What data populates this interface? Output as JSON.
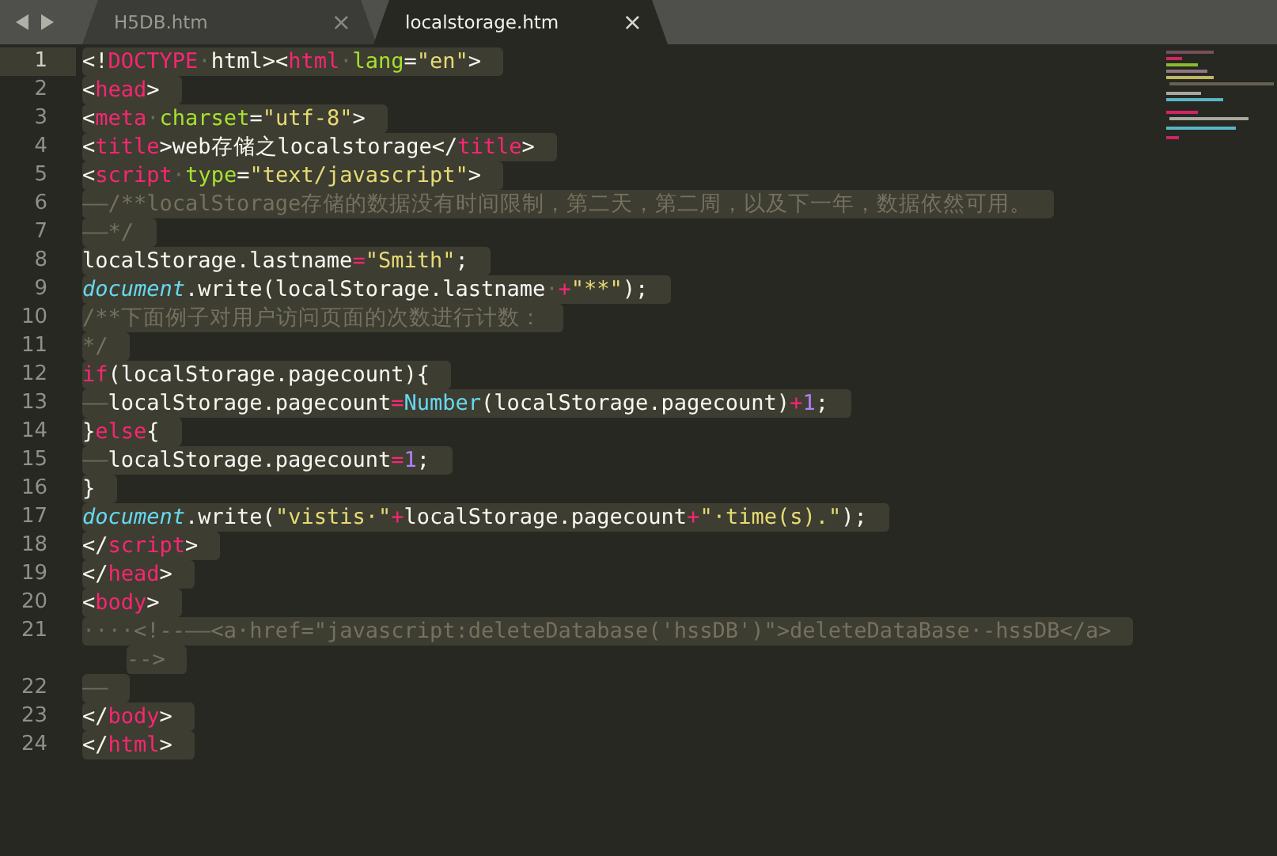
{
  "tabs": [
    {
      "label": "H5DB.htm",
      "close": "×",
      "selected": false
    },
    {
      "label": "localstorage.htm",
      "close": "×",
      "selected": true
    }
  ],
  "lines": [
    {
      "number": "1",
      "current": true,
      "selected": true,
      "tokens": [
        {
          "kind": "txt",
          "text": "<!"
        },
        {
          "kind": "tag",
          "text": "DOCTYPE"
        },
        {
          "kind": "ws",
          "text": "·"
        },
        {
          "kind": "txt",
          "text": "html><"
        },
        {
          "kind": "tag",
          "text": "html"
        },
        {
          "kind": "ws",
          "text": "·"
        },
        {
          "kind": "attr",
          "text": "lang"
        },
        {
          "kind": "txt",
          "text": "="
        },
        {
          "kind": "str",
          "text": "\"en\""
        },
        {
          "kind": "txt",
          "text": ">"
        }
      ]
    },
    {
      "number": "2",
      "current": false,
      "selected": true,
      "tokens": [
        {
          "kind": "txt",
          "text": "<"
        },
        {
          "kind": "tag",
          "text": "head"
        },
        {
          "kind": "txt",
          "text": ">"
        }
      ]
    },
    {
      "number": "3",
      "current": false,
      "selected": true,
      "tokens": [
        {
          "kind": "txt",
          "text": "<"
        },
        {
          "kind": "tag",
          "text": "meta"
        },
        {
          "kind": "ws",
          "text": "·"
        },
        {
          "kind": "attr",
          "text": "charset"
        },
        {
          "kind": "txt",
          "text": "="
        },
        {
          "kind": "str",
          "text": "\"utf-8\""
        },
        {
          "kind": "txt",
          "text": ">"
        }
      ]
    },
    {
      "number": "4",
      "current": false,
      "selected": true,
      "tokens": [
        {
          "kind": "txt",
          "text": "<"
        },
        {
          "kind": "tag",
          "text": "title"
        },
        {
          "kind": "txt",
          "text": ">web存储之localstorage</"
        },
        {
          "kind": "tag",
          "text": "title"
        },
        {
          "kind": "txt",
          "text": ">"
        }
      ]
    },
    {
      "number": "5",
      "current": false,
      "selected": true,
      "tokens": [
        {
          "kind": "txt",
          "text": "<"
        },
        {
          "kind": "tag",
          "text": "script"
        },
        {
          "kind": "ws",
          "text": "·"
        },
        {
          "kind": "attr",
          "text": "type"
        },
        {
          "kind": "txt",
          "text": "="
        },
        {
          "kind": "str",
          "text": "\"text/javascript\""
        },
        {
          "kind": "txt",
          "text": ">"
        }
      ]
    },
    {
      "number": "6",
      "current": false,
      "selected": true,
      "tokens": [
        {
          "kind": "ws",
          "text": "——"
        },
        {
          "kind": "cmt",
          "text": "/**localStorage存储的数据没有时间限制，第二天，第二周，以及下一年，数据依然可用。"
        }
      ]
    },
    {
      "number": "7",
      "current": false,
      "selected": true,
      "tokens": [
        {
          "kind": "ws",
          "text": "——"
        },
        {
          "kind": "cmt",
          "text": "*/"
        }
      ]
    },
    {
      "number": "8",
      "current": false,
      "selected": true,
      "tokens": [
        {
          "kind": "txt",
          "text": "localStorage.lastname"
        },
        {
          "kind": "op",
          "text": "="
        },
        {
          "kind": "str",
          "text": "\"Smith\""
        },
        {
          "kind": "txt",
          "text": ";"
        }
      ]
    },
    {
      "number": "9",
      "current": false,
      "selected": true,
      "tokens": [
        {
          "kind": "obj",
          "text": "document"
        },
        {
          "kind": "txt",
          "text": ".write(localStorage.lastname"
        },
        {
          "kind": "ws",
          "text": "·"
        },
        {
          "kind": "op",
          "text": "+"
        },
        {
          "kind": "str",
          "text": "\"**\""
        },
        {
          "kind": "txt",
          "text": ");"
        }
      ]
    },
    {
      "number": "10",
      "current": false,
      "selected": true,
      "tokens": [
        {
          "kind": "cmt",
          "text": "/**下面例子对用户访问页面的次数进行计数："
        }
      ]
    },
    {
      "number": "11",
      "current": false,
      "selected": true,
      "tokens": [
        {
          "kind": "cmt",
          "text": "*/"
        }
      ]
    },
    {
      "number": "12",
      "current": false,
      "selected": true,
      "tokens": [
        {
          "kind": "kw",
          "text": "if"
        },
        {
          "kind": "txt",
          "text": "(localStorage.pagecount){"
        }
      ]
    },
    {
      "number": "13",
      "current": false,
      "selected": true,
      "tokens": [
        {
          "kind": "ws",
          "text": "——"
        },
        {
          "kind": "txt",
          "text": "localStorage.pagecount"
        },
        {
          "kind": "op",
          "text": "="
        },
        {
          "kind": "type",
          "text": "Number"
        },
        {
          "kind": "txt",
          "text": "(localStorage.pagecount)"
        },
        {
          "kind": "op",
          "text": "+"
        },
        {
          "kind": "num",
          "text": "1"
        },
        {
          "kind": "txt",
          "text": ";"
        }
      ]
    },
    {
      "number": "14",
      "current": false,
      "selected": true,
      "tokens": [
        {
          "kind": "txt",
          "text": "}"
        },
        {
          "kind": "kw",
          "text": "else"
        },
        {
          "kind": "txt",
          "text": "{"
        }
      ]
    },
    {
      "number": "15",
      "current": false,
      "selected": true,
      "tokens": [
        {
          "kind": "ws",
          "text": "——"
        },
        {
          "kind": "txt",
          "text": "localStorage.pagecount"
        },
        {
          "kind": "op",
          "text": "="
        },
        {
          "kind": "num",
          "text": "1"
        },
        {
          "kind": "txt",
          "text": ";"
        }
      ]
    },
    {
      "number": "16",
      "current": false,
      "selected": true,
      "tokens": [
        {
          "kind": "txt",
          "text": "}"
        }
      ]
    },
    {
      "number": "17",
      "current": false,
      "selected": true,
      "tokens": [
        {
          "kind": "obj",
          "text": "document"
        },
        {
          "kind": "txt",
          "text": ".write("
        },
        {
          "kind": "str",
          "text": "\"vistis·\""
        },
        {
          "kind": "op",
          "text": "+"
        },
        {
          "kind": "txt",
          "text": "localStorage.pagecount"
        },
        {
          "kind": "op",
          "text": "+"
        },
        {
          "kind": "str",
          "text": "\"·time(s).\""
        },
        {
          "kind": "txt",
          "text": ");"
        }
      ]
    },
    {
      "number": "18",
      "current": false,
      "selected": true,
      "tokens": [
        {
          "kind": "txt",
          "text": "</"
        },
        {
          "kind": "tag",
          "text": "script"
        },
        {
          "kind": "txt",
          "text": ">"
        }
      ]
    },
    {
      "number": "19",
      "current": false,
      "selected": true,
      "tokens": [
        {
          "kind": "txt",
          "text": "</"
        },
        {
          "kind": "tag",
          "text": "head"
        },
        {
          "kind": "txt",
          "text": ">"
        }
      ]
    },
    {
      "number": "20",
      "current": false,
      "selected": true,
      "tokens": [
        {
          "kind": "txt",
          "text": "<"
        },
        {
          "kind": "tag",
          "text": "body"
        },
        {
          "kind": "txt",
          "text": ">"
        }
      ]
    },
    {
      "number": "21",
      "current": false,
      "selected": true,
      "tokens": [
        {
          "kind": "ws",
          "text": "····"
        },
        {
          "kind": "cmt",
          "text": "<!--"
        },
        {
          "kind": "ws",
          "text": "——"
        },
        {
          "kind": "cmt",
          "text": "<a·href=\"javascript:deleteDatabase('hssDB')\">deleteDataBase·-hssDB</a>"
        }
      ],
      "continuation": [
        {
          "kind": "cmt",
          "text": "-->"
        }
      ]
    },
    {
      "number": "22",
      "current": false,
      "selected": true,
      "tokens": [
        {
          "kind": "ws",
          "text": "——"
        }
      ]
    },
    {
      "number": "23",
      "current": false,
      "selected": true,
      "tokens": [
        {
          "kind": "txt",
          "text": "</"
        },
        {
          "kind": "tag",
          "text": "body"
        },
        {
          "kind": "txt",
          "text": ">"
        }
      ]
    },
    {
      "number": "24",
      "current": false,
      "selected": true,
      "tokens": [
        {
          "kind": "txt",
          "text": "</"
        },
        {
          "kind": "tag",
          "text": "html"
        },
        {
          "kind": "txt",
          "text": ">"
        }
      ]
    }
  ]
}
